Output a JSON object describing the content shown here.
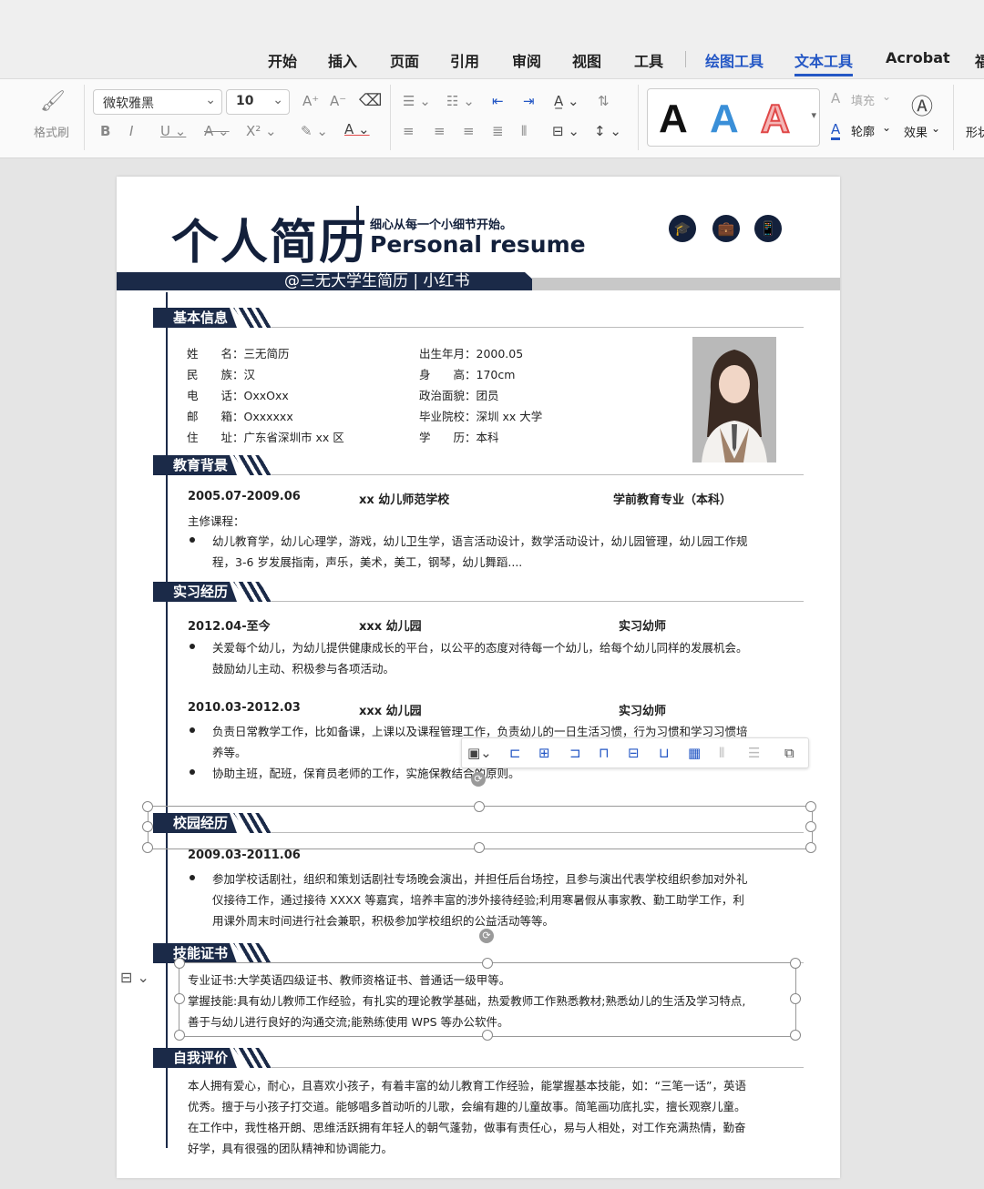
{
  "ribbon_tabs": [
    "开始",
    "插入",
    "页面",
    "引用",
    "审阅",
    "视图",
    "工具",
    "绘图工具",
    "文本工具",
    "Acrobat",
    "福"
  ],
  "ribbon": {
    "format_painter": "格式刷",
    "font_name": "微软雅黑",
    "font_size": "10",
    "fill_label": "填充",
    "outline_label": "轮廓",
    "effects_label": "效果",
    "shape_label": "形状",
    "style_glyph": "A"
  },
  "resume": {
    "title_cn": "个人简历",
    "motto": "细心从每一个小细节开始。",
    "title_en": "Personal resume",
    "banner": "@三无大学生简历 | 小红书",
    "sections": {
      "basic": "基本信息",
      "education": "教育背景",
      "internship": "实习经历",
      "campus": "校园经历",
      "skills": "技能证书",
      "self_eval": "自我评价"
    },
    "basic_info": {
      "name": "姓　　名：三无简历",
      "ethnicity": "民　　族：汉",
      "phone": "电　　话：OxxOxx",
      "email": "邮　　箱：Oxxxxxx",
      "address": "住　　址：广东省深圳市 xx 区",
      "birth": "出生年月：2000.05",
      "height": "身　　高：170cm",
      "politics": "政治面貌：团员",
      "school": "毕业院校：深圳 xx 大学",
      "degree": "学　　历：本科"
    },
    "education": {
      "period": "2005.07-2009.06",
      "school": "xx 幼儿师范学校",
      "major": "学前教育专业（本科）",
      "courses_label": "主修课程：",
      "courses_1": "幼儿教育学，幼儿心理学，游戏，幼儿卫生学，语言活动设计，数学活动设计，幼儿园管理，幼儿园工作规",
      "courses_2": "程，3-6 岁发展指南，声乐，美术，美工，钢琴，幼儿舞蹈...."
    },
    "internship": [
      {
        "period": "2012.04-至今",
        "org": "xxx 幼儿园",
        "role": "实习幼师",
        "desc_1": "关爱每个幼儿，为幼儿提供健康成长的平台，以公平的态度对待每一个幼儿，给每个幼儿同样的发展机会。",
        "desc_2": "鼓励幼儿主动、积极参与各项活动。"
      },
      {
        "period": "2010.03-2012.03",
        "org": "xxx 幼儿园",
        "role": "实习幼师",
        "desc_1": "负责日常教学工作，比如备课，上课以及课程管理工作，负责幼儿的一日生活习惯，行为习惯和学习习惯培",
        "desc_2": "养等。",
        "desc_3": "协助主班，配班，保育员老师的工作，实施保教结合的原则。"
      }
    ],
    "campus": {
      "period": "2009.03-2011.06",
      "desc_1": "参加学校话剧社，组织和策划话剧社专场晚会演出，并担任后台场控，且参与演出代表学校组织参加对外礼",
      "desc_2": "仪接待工作，通过接待 XXXX 等嘉宾，培养丰富的涉外接待经验;利用寒暑假从事家教、勤工助学工作，利",
      "desc_3": "用课外周末时间进行社会兼职，积极参加学校组织的公益活动等等。"
    },
    "skills": {
      "line_1": "专业证书:大学英语四级证书、教师资格证书、普通话一级甲等。",
      "line_2": "掌握技能:具有幼儿教师工作经验，有扎实的理论教学基础，热爱教师工作熟悉教材;熟悉幼儿的生活及学习特点,",
      "line_3": "善于与幼儿进行良好的沟通交流;能熟练使用 WPS 等办公软件。"
    },
    "self_eval": {
      "line_1": "本人拥有爱心，耐心，且喜欢小孩子，有着丰富的幼儿教育工作经验，能掌握基本技能，如：“三笔一话”，英语",
      "line_2": "优秀。擅于与小孩子打交道。能够唱多首动听的儿歌，会编有趣的儿童故事。简笔画功底扎实，擅长观察儿童。",
      "line_3": "在工作中，我性格开朗、思维活跃拥有年轻人的朝气蓬勃，做事有责任心，易与人相处，对工作充满热情，勤奋",
      "line_4": "好学，具有很强的团队精神和协调能力。"
    }
  },
  "colors": {
    "navy": "#1b2a48",
    "accent_blue": "#2457c5",
    "red_A": "#e04848"
  }
}
